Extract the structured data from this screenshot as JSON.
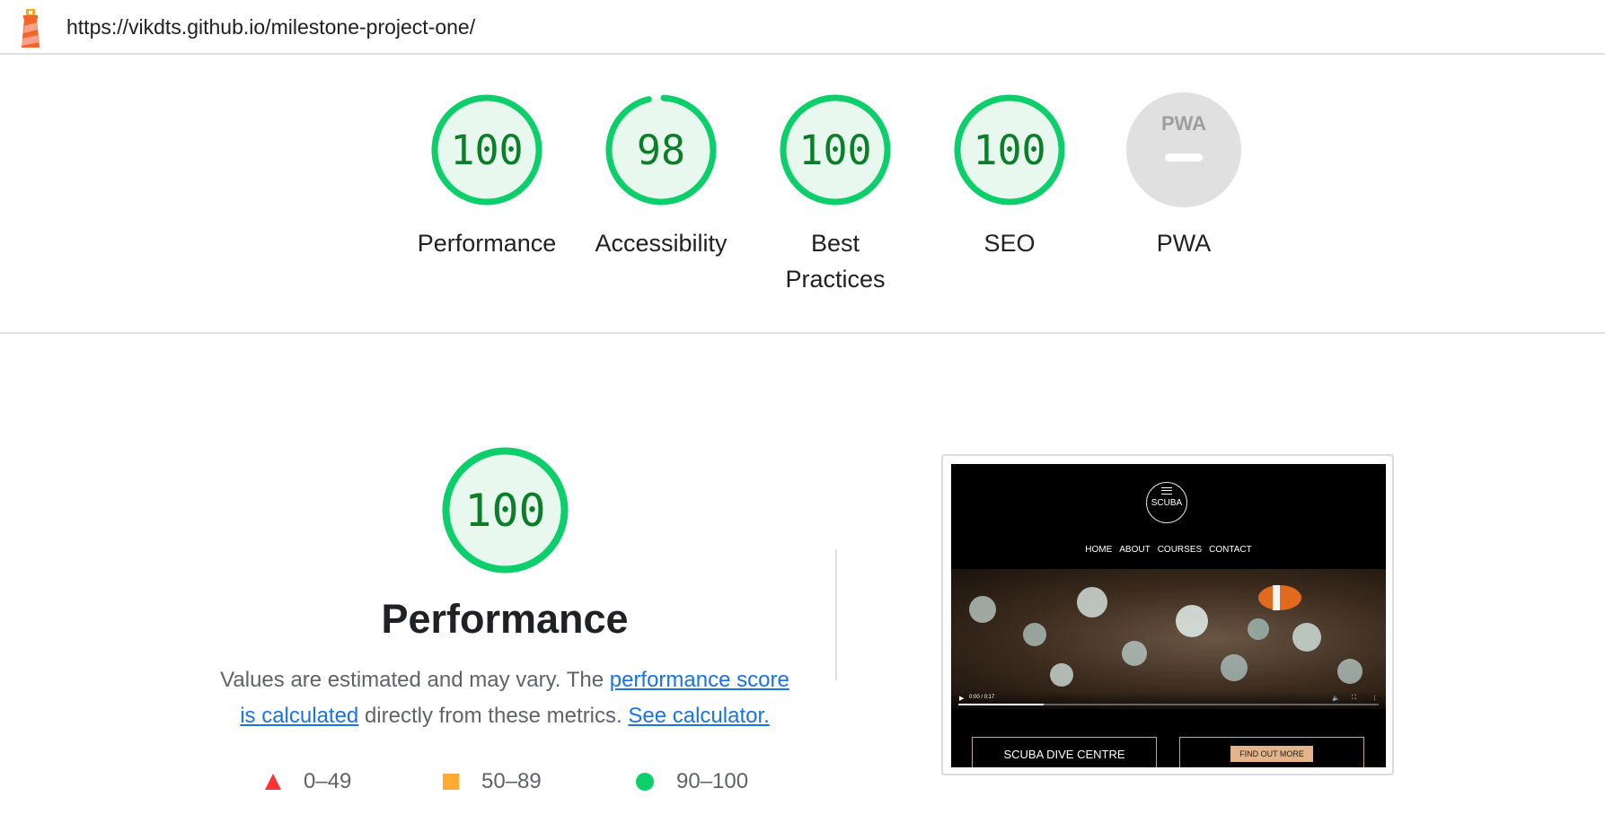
{
  "header": {
    "url": "https://vikdts.github.io/milestone-project-one/",
    "logo_icon": "lighthouse-icon"
  },
  "summary_scores": [
    {
      "name": "performance",
      "label": "Performance",
      "score": "100",
      "fraction": 1.0
    },
    {
      "name": "accessibility",
      "label": "Accessibility",
      "score": "98",
      "fraction": 0.98
    },
    {
      "name": "best-practices",
      "label": "Best Practices",
      "label_line1": "Best",
      "label_line2": "Practices",
      "score": "100",
      "fraction": 1.0
    },
    {
      "name": "seo",
      "label": "SEO",
      "score": "100",
      "fraction": 1.0
    },
    {
      "name": "pwa",
      "label": "PWA",
      "badge_text": "PWA",
      "fraction": 0
    }
  ],
  "performance_section": {
    "score": "100",
    "fraction": 1.0,
    "title": "Performance",
    "desc_part1": "Values are estimated and may vary. The ",
    "link_score_calc": "performance score is calculated",
    "desc_part2": " directly from these metrics. ",
    "link_calculator": "See calculator.",
    "legend": [
      {
        "shape": "triangle",
        "color": "#ff3333",
        "range": "0–49"
      },
      {
        "shape": "square",
        "color": "#ffaa33",
        "range": "50–89"
      },
      {
        "shape": "circle",
        "color": "#0cce6b",
        "range": "90–100"
      }
    ]
  },
  "screenshot": {
    "logo_text": "SCUBA",
    "nav": [
      "HOME",
      "ABOUT",
      "COURSES",
      "CONTACT"
    ],
    "video_time": "0:00 / 0:17",
    "box_left": "SCUBA DIVE CENTRE",
    "box_right_button": "FIND OUT MORE"
  },
  "colors": {
    "pass_green": "#0cce6b",
    "pass_text": "#0c7e2a",
    "pass_fill": "#e8f8ee",
    "link_blue": "#1a73e8",
    "pwa_grey": "#e0e0e0"
  }
}
